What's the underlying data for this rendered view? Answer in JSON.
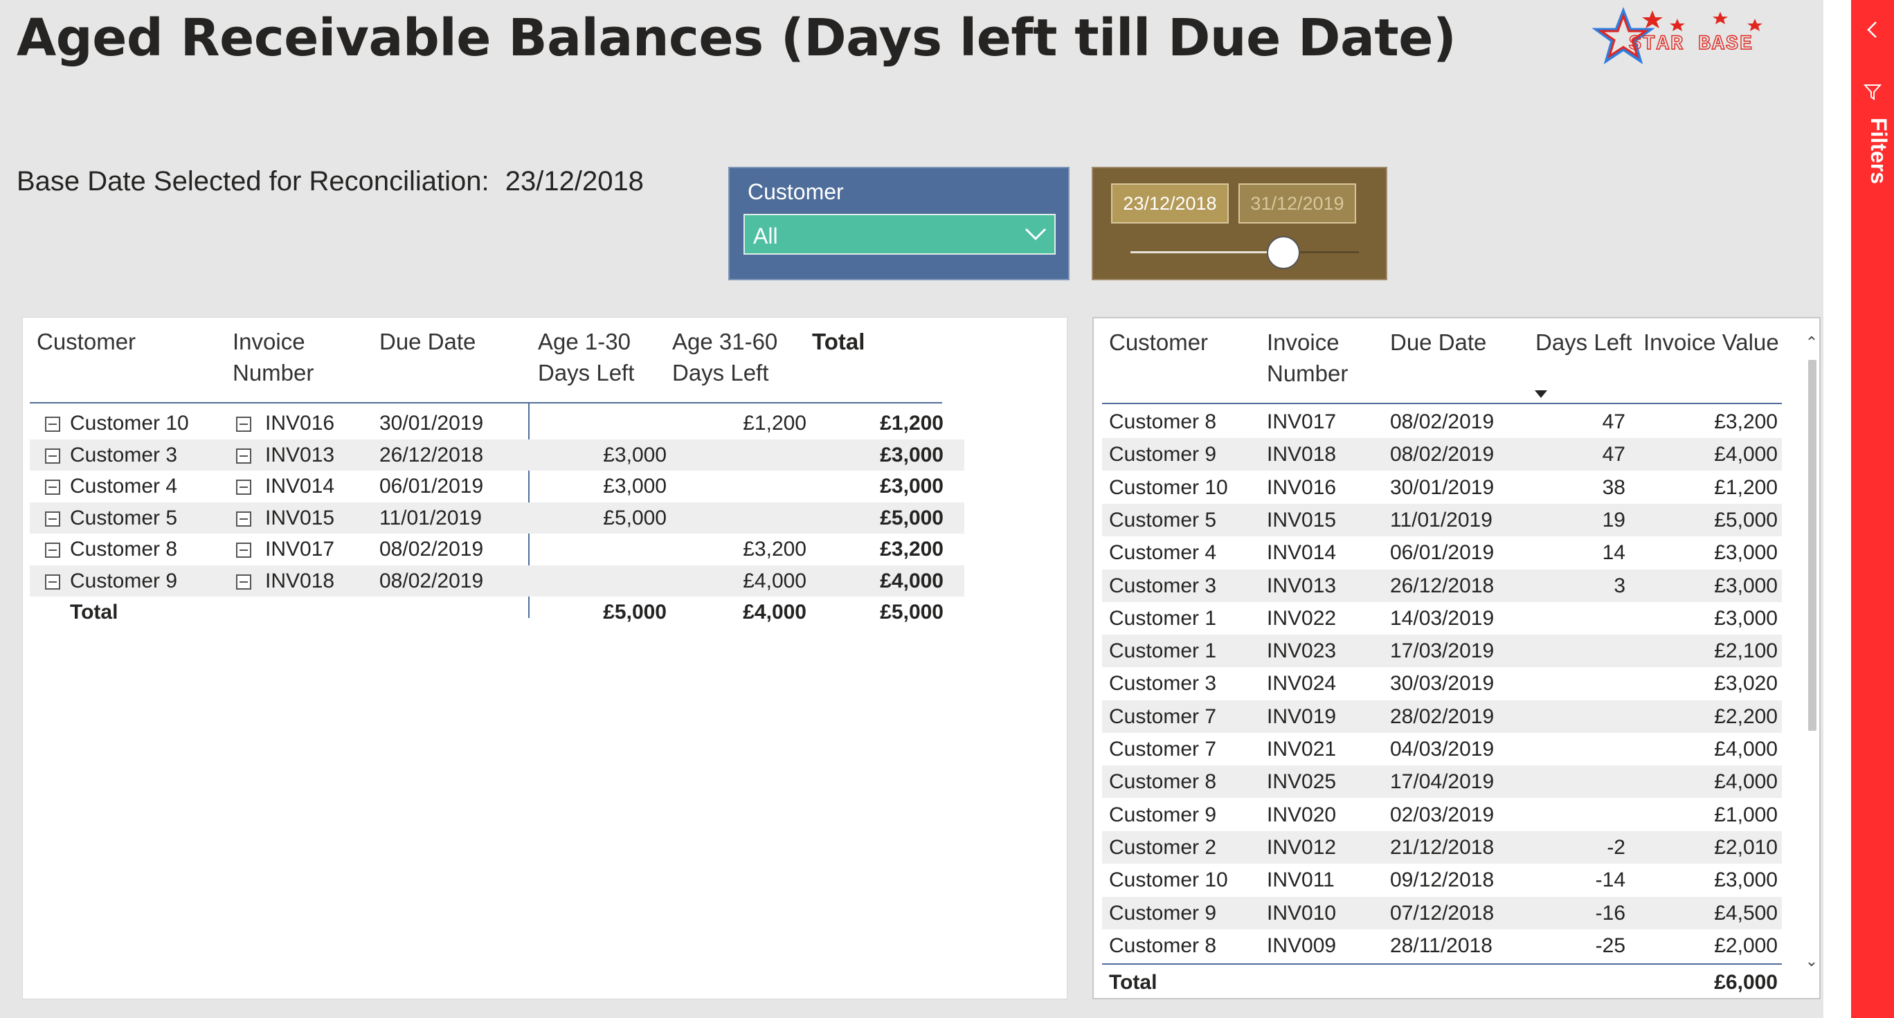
{
  "page": {
    "title": "Aged Receivable Balances (Days left till Due Date)",
    "base_date_label": "Base Date Selected for Reconciliation:",
    "base_date_value": "23/12/2018"
  },
  "logo": {
    "text": "STAR BASE",
    "icon": "star-logo-icon"
  },
  "customer_slicer": {
    "header": "Customer",
    "selected": "All",
    "icon": "chevron-down-icon"
  },
  "date_slicer": {
    "start": "23/12/2018",
    "end": "31/12/2019",
    "position": 0.67
  },
  "matrix": {
    "headers": {
      "customer": "Customer",
      "invoice_line1": "Invoice",
      "invoice_line2": "Number",
      "due_date": "Due Date",
      "age1_line1": "Age 1-30",
      "age1_line2": "Days Left",
      "age2_line1": "Age 31-60",
      "age2_line2": "Days Left",
      "total": "Total"
    },
    "rows": [
      {
        "customer": "Customer 10",
        "invoice": "INV016",
        "due": "30/01/2019",
        "age1": "",
        "age2": "£1,200",
        "total": "£1,200"
      },
      {
        "customer": "Customer 3",
        "invoice": "INV013",
        "due": "26/12/2018",
        "age1": "£3,000",
        "age2": "",
        "total": "£3,000"
      },
      {
        "customer": "Customer 4",
        "invoice": "INV014",
        "due": "06/01/2019",
        "age1": "£3,000",
        "age2": "",
        "total": "£3,000"
      },
      {
        "customer": "Customer 5",
        "invoice": "INV015",
        "due": "11/01/2019",
        "age1": "£5,000",
        "age2": "",
        "total": "£5,000"
      },
      {
        "customer": "Customer 8",
        "invoice": "INV017",
        "due": "08/02/2019",
        "age1": "",
        "age2": "£3,200",
        "total": "£3,200"
      },
      {
        "customer": "Customer 9",
        "invoice": "INV018",
        "due": "08/02/2019",
        "age1": "",
        "age2": "£4,000",
        "total": "£4,000"
      }
    ],
    "total_row": {
      "label": "Total",
      "age1": "£5,000",
      "age2": "£4,000",
      "total": "£5,000"
    }
  },
  "table": {
    "headers": {
      "customer": "Customer",
      "invoice_line1": "Invoice",
      "invoice_line2": "Number",
      "due_date": "Due Date",
      "days_left": "Days Left",
      "invoice_value": "Invoice Value"
    },
    "rows": [
      {
        "customer": "Customer 8",
        "invoice": "INV017",
        "due": "08/02/2019",
        "days": "47",
        "value": "£3,200"
      },
      {
        "customer": "Customer 9",
        "invoice": "INV018",
        "due": "08/02/2019",
        "days": "47",
        "value": "£4,000"
      },
      {
        "customer": "Customer 10",
        "invoice": "INV016",
        "due": "30/01/2019",
        "days": "38",
        "value": "£1,200"
      },
      {
        "customer": "Customer 5",
        "invoice": "INV015",
        "due": "11/01/2019",
        "days": "19",
        "value": "£5,000"
      },
      {
        "customer": "Customer 4",
        "invoice": "INV014",
        "due": "06/01/2019",
        "days": "14",
        "value": "£3,000"
      },
      {
        "customer": "Customer 3",
        "invoice": "INV013",
        "due": "26/12/2018",
        "days": "3",
        "value": "£3,000"
      },
      {
        "customer": "Customer 1",
        "invoice": "INV022",
        "due": "14/03/2019",
        "days": "",
        "value": "£3,000"
      },
      {
        "customer": "Customer 1",
        "invoice": "INV023",
        "due": "17/03/2019",
        "days": "",
        "value": "£2,100"
      },
      {
        "customer": "Customer 3",
        "invoice": "INV024",
        "due": "30/03/2019",
        "days": "",
        "value": "£3,020"
      },
      {
        "customer": "Customer 7",
        "invoice": "INV019",
        "due": "28/02/2019",
        "days": "",
        "value": "£2,200"
      },
      {
        "customer": "Customer 7",
        "invoice": "INV021",
        "due": "04/03/2019",
        "days": "",
        "value": "£4,000"
      },
      {
        "customer": "Customer 8",
        "invoice": "INV025",
        "due": "17/04/2019",
        "days": "",
        "value": "£4,000"
      },
      {
        "customer": "Customer 9",
        "invoice": "INV020",
        "due": "02/03/2019",
        "days": "",
        "value": "£1,000"
      },
      {
        "customer": "Customer 2",
        "invoice": "INV012",
        "due": "21/12/2018",
        "days": "-2",
        "value": "£2,010"
      },
      {
        "customer": "Customer 10",
        "invoice": "INV011",
        "due": "09/12/2018",
        "days": "-14",
        "value": "£3,000"
      },
      {
        "customer": "Customer 9",
        "invoice": "INV010",
        "due": "07/12/2018",
        "days": "-16",
        "value": "£4,500"
      },
      {
        "customer": "Customer 8",
        "invoice": "INV009",
        "due": "28/11/2018",
        "days": "-25",
        "value": "£2,000"
      }
    ],
    "total_row": {
      "label": "Total",
      "value": "£6,000"
    }
  },
  "filters_pane": {
    "label": "Filters",
    "icons": [
      "chevron-left-icon",
      "filter-icon"
    ]
  },
  "colors": {
    "customer_slicer_bg": "#4e6d9a",
    "customer_dropdown_bg": "#4ebfa1",
    "date_slicer_bg": "#7a6236",
    "filters_pane_bg": "#ff2d2d",
    "accent_rule": "#4e6d9a"
  }
}
